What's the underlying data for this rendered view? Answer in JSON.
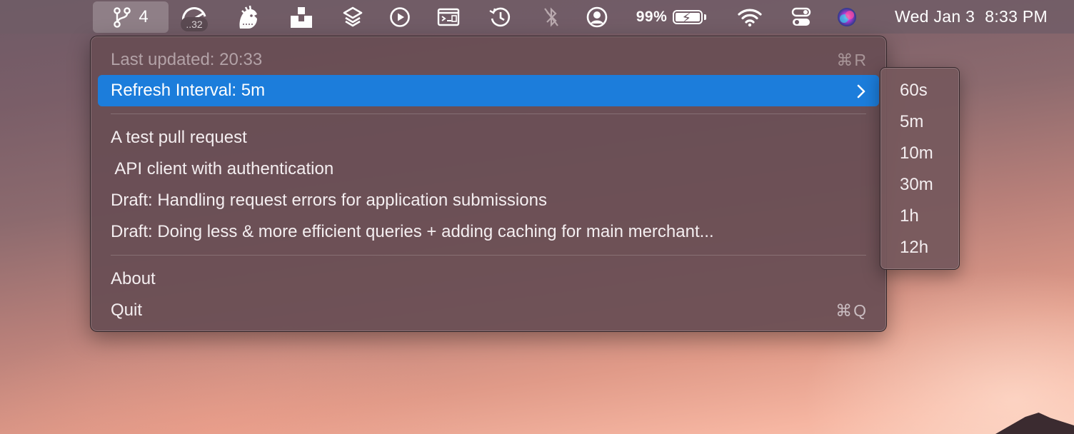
{
  "menubar": {
    "pr_app_count": "4",
    "badge": "..32",
    "battery_percent": "99%",
    "date": "Wed Jan 3",
    "time": "8:33 PM",
    "icons": [
      "git-branch-icon",
      "speed-gauge-icon",
      "hedgehog-icon",
      "unarchiver-icon",
      "stack-icon",
      "play-circle-icon",
      "terminal-window-icon",
      "time-machine-icon",
      "bluetooth-off-icon",
      "user-circle-icon",
      "battery-icon",
      "wifi-icon",
      "control-center-icon",
      "siri-icon"
    ]
  },
  "menu": {
    "last_updated": {
      "label": "Last updated: 20:33",
      "shortcut": "⌘R"
    },
    "refresh_interval": {
      "label": "Refresh Interval: 5m"
    },
    "pull_requests": [
      "A test pull request",
      " API client with authentication",
      "Draft: Handling request errors for application submissions",
      "Draft: Doing less & more efficient queries + adding caching for main merchant..."
    ],
    "about": "About",
    "quit": {
      "label": "Quit",
      "shortcut": "⌘Q"
    }
  },
  "submenu": {
    "options": [
      "60s",
      "5m",
      "10m",
      "30m",
      "1h",
      "12h"
    ],
    "selected": "5m"
  },
  "colors": {
    "highlight": "#1c7ddb",
    "menu_bg": "#684e54"
  }
}
